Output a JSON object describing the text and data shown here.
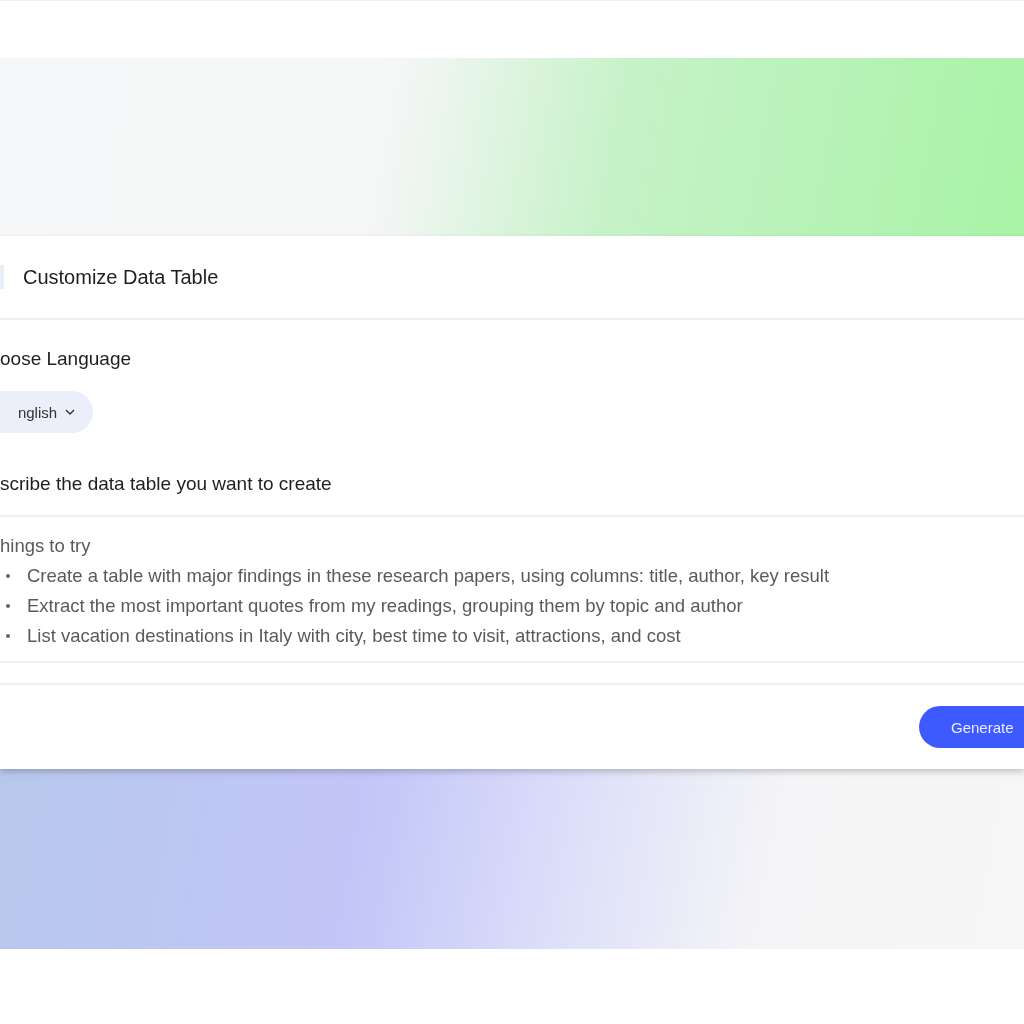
{
  "dialog": {
    "title": "Customize Data Table"
  },
  "language": {
    "label": "oose Language",
    "value": "nglish"
  },
  "prompt": {
    "label": "scribe the data table you want to create",
    "placeholder_heading": "hings to try",
    "placeholder_items": [
      "Create a table with major findings in these research papers, using columns: title, author, key result",
      "Extract the most important quotes from my readings, grouping them by topic and author",
      "List vacation destinations in Italy with city, best time to visit, attractions, and cost"
    ]
  },
  "buttons": [
    {
      "label": "Generate",
      "kind": "primary"
    }
  ]
}
